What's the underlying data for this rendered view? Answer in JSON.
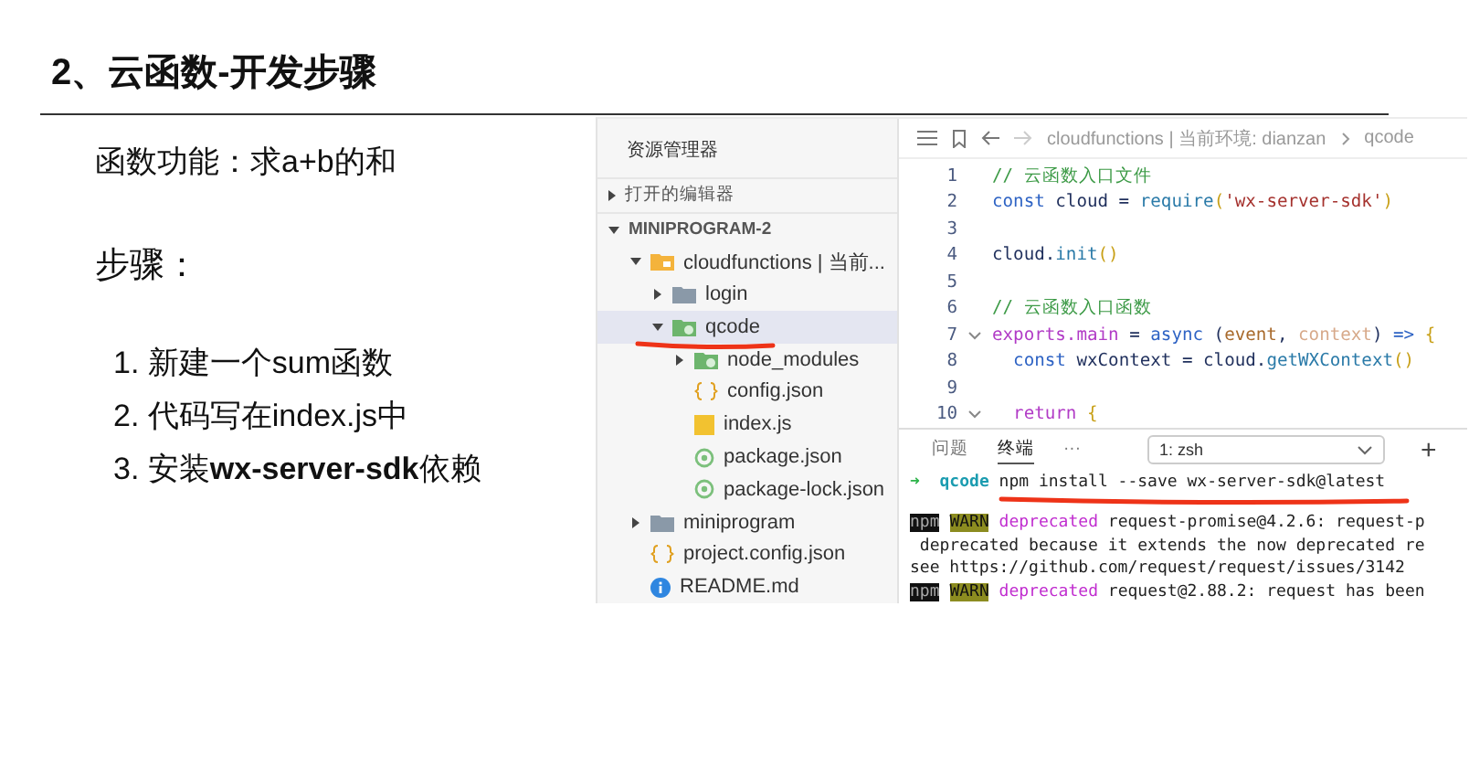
{
  "slide": {
    "title": "2、云函数-开发步骤",
    "intro": "函数功能：求a+b的和",
    "steps_heading": "步骤：",
    "steps": [
      "1. 新建一个sum函数",
      "2. 代码写在index.js中",
      "3. 安装**wx-server-sdk**依赖"
    ]
  },
  "explorer": {
    "title": "资源管理器",
    "sections": [
      {
        "label": "打开的编辑器",
        "expanded": false
      },
      {
        "label": "MINIPROGRAM-2",
        "expanded": true
      }
    ],
    "tree": [
      {
        "label": "cloudfunctions | 当前...",
        "kind": "cloud-folder",
        "expanded": true,
        "selected": false,
        "children": [
          {
            "label": "login",
            "kind": "folder",
            "expanded": false,
            "selected": false
          },
          {
            "label": "qcode",
            "kind": "function-folder",
            "expanded": true,
            "selected": true,
            "underlined": true,
            "children": [
              {
                "label": "node_modules",
                "kind": "function-folder",
                "expanded": false,
                "selected": false
              },
              {
                "label": "config.json",
                "kind": "json",
                "selected": false
              },
              {
                "label": "index.js",
                "kind": "js",
                "selected": false
              },
              {
                "label": "package.json",
                "kind": "package",
                "selected": false
              },
              {
                "label": "package-lock.json",
                "kind": "package",
                "selected": false
              }
            ]
          }
        ]
      },
      {
        "label": "miniprogram",
        "kind": "folder",
        "expanded": false,
        "selected": false
      },
      {
        "label": "project.config.json",
        "kind": "json",
        "selected": false
      },
      {
        "label": "README.md",
        "kind": "info",
        "selected": false
      }
    ]
  },
  "editor": {
    "breadcrumb": [
      "cloudfunctions | 当前环境: dianzan",
      "qcode"
    ],
    "lines": [
      {
        "number": "1",
        "foldable": false,
        "tokens": [
          {
            "text": "// 云函数入口文件",
            "kind": "comment"
          }
        ]
      },
      {
        "number": "2",
        "foldable": false,
        "tokens": [
          {
            "text": "const ",
            "kind": "keyword"
          },
          {
            "text": "cloud = ",
            "kind": "plain"
          },
          {
            "text": "require",
            "kind": "func"
          },
          {
            "text": "(",
            "kind": "bracket"
          },
          {
            "text": "'wx-server-sdk'",
            "kind": "string"
          },
          {
            "text": ")",
            "kind": "bracket"
          }
        ]
      },
      {
        "number": "3",
        "foldable": false
      },
      {
        "number": "4",
        "foldable": false,
        "tokens": [
          {
            "text": "cloud.",
            "kind": "plain"
          },
          {
            "text": "init",
            "kind": "func"
          },
          {
            "text": "()",
            "kind": "bracket"
          }
        ]
      },
      {
        "number": "5",
        "foldable": false
      },
      {
        "number": "6",
        "foldable": false,
        "tokens": [
          {
            "text": "// 云函数入口函数",
            "kind": "comment"
          }
        ]
      },
      {
        "number": "7",
        "foldable": true,
        "tokens": [
          {
            "text": "exports.main",
            "kind": "storage"
          },
          {
            "text": " = ",
            "kind": "plain"
          },
          {
            "text": "async ",
            "kind": "keyword"
          },
          {
            "text": "(",
            "kind": "plain"
          },
          {
            "text": "event",
            "kind": "param"
          },
          {
            "text": ", ",
            "kind": "plain"
          },
          {
            "text": "context",
            "kind": "param-dim"
          },
          {
            "text": ") ",
            "kind": "plain"
          },
          {
            "text": "=> ",
            "kind": "keyword"
          },
          {
            "text": "{",
            "kind": "bracket"
          }
        ]
      },
      {
        "number": "8",
        "foldable": false,
        "tokens": [
          {
            "text": "  const ",
            "kind": "keyword"
          },
          {
            "text": "wxContext = cloud.",
            "kind": "plain"
          },
          {
            "text": "getWXContext",
            "kind": "func"
          },
          {
            "text": "()",
            "kind": "bracket"
          }
        ]
      },
      {
        "number": "9",
        "foldable": false
      },
      {
        "number": "10",
        "foldable": true,
        "tokens": [
          {
            "text": "  return ",
            "kind": "storage"
          },
          {
            "text": "{",
            "kind": "bracket"
          }
        ]
      }
    ]
  },
  "terminal": {
    "tabs": [
      {
        "label": "问题",
        "selected": false
      },
      {
        "label": "终端",
        "selected": true
      },
      {
        "label": "···",
        "selected": false
      }
    ],
    "shell": "1: zsh",
    "add": "+",
    "prompt": {
      "arrow": "➜",
      "dir": "qcode",
      "command": "npm install --save wx-server-sdk@latest",
      "underlined": true
    },
    "output": [
      {
        "kind": "warn",
        "npm": "npm",
        "level": "WARN",
        "tag": "deprecated",
        "text": " request-promise@4.2.6: request-p"
      },
      {
        "kind": "plain",
        "text": " deprecated because it extends the now deprecated re"
      },
      {
        "kind": "plain",
        "text": "see https://github.com/request/request/issues/3142"
      },
      {
        "kind": "warn",
        "npm": "npm",
        "level": "WARN",
        "tag": "deprecated",
        "text": " request@2.88.2: request has been"
      }
    ]
  }
}
